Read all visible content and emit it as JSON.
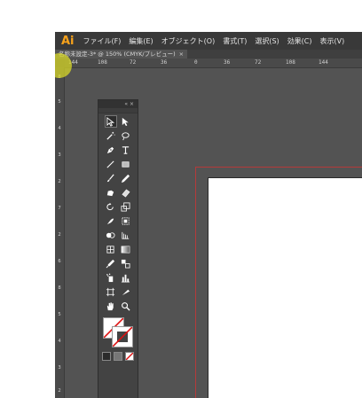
{
  "app": {
    "logo": "Ai",
    "menu": [
      "ファイル(F)",
      "編集(E)",
      "オブジェクト(O)",
      "書式(T)",
      "選択(S)",
      "効果(C)",
      "表示(V)"
    ]
  },
  "document_tab": {
    "title": "名称未設定-3* @ 150% (CMYK/プレビュー)",
    "close": "×"
  },
  "ruler_h": [
    "144",
    "108",
    "72",
    "36",
    "0",
    "36",
    "72",
    "108",
    "144"
  ],
  "ruler_v": [
    "8",
    "5",
    "4",
    "3",
    "2",
    "7",
    "2",
    "6",
    "8",
    "5",
    "4",
    "3",
    "2"
  ],
  "tools_panel": {
    "collapse": "« ×",
    "tools": [
      [
        "selection-icon",
        "direct-selection-icon"
      ],
      [
        "magic-wand-icon",
        "lasso-icon"
      ],
      [
        "pen-icon",
        "type-icon"
      ],
      [
        "line-icon",
        "rectangle-icon"
      ],
      [
        "paintbrush-icon",
        "pencil-icon"
      ],
      [
        "blob-brush-icon",
        "eraser-icon"
      ],
      [
        "rotate-icon",
        "scale-icon"
      ],
      [
        "warp-icon",
        "free-transform-icon"
      ],
      [
        "shape-builder-icon",
        "perspective-grid-icon"
      ],
      [
        "mesh-icon",
        "gradient-icon"
      ],
      [
        "eyedropper-icon",
        "blend-icon"
      ],
      [
        "symbol-sprayer-icon",
        "column-graph-icon"
      ],
      [
        "artboard-icon",
        "slice-icon"
      ],
      [
        "hand-icon",
        "zoom-icon"
      ]
    ]
  },
  "colors": {
    "accent": "#f7a21b",
    "workspace": "#535353",
    "bleed": "#b53a3a",
    "cursor_highlight": "#d7d728"
  }
}
